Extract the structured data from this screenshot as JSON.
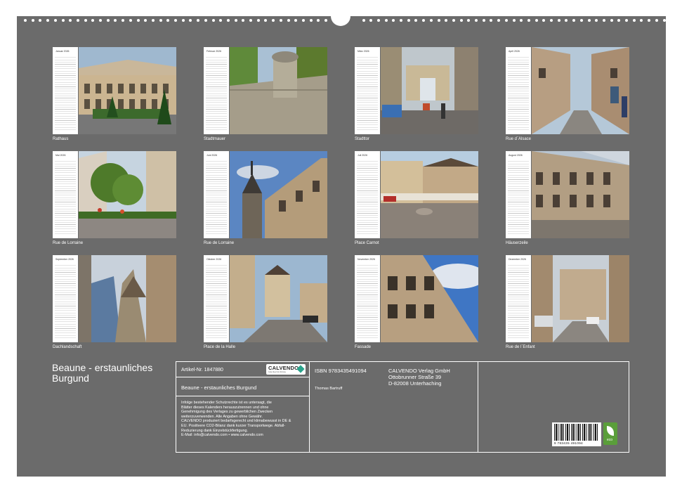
{
  "months": [
    {
      "month": "Januar",
      "year": "2026",
      "caption": "Rathaus",
      "scene": "courtyard"
    },
    {
      "month": "Februar",
      "year": "2026",
      "caption": "Stadtmauer",
      "scene": "wall"
    },
    {
      "month": "März",
      "year": "2026",
      "caption": "Stadttor",
      "scene": "gate"
    },
    {
      "month": "April",
      "year": "2026",
      "caption": "Rue d`Alsace",
      "scene": "street"
    },
    {
      "month": "Mai",
      "year": "2026",
      "caption": "Rue de Lorraine",
      "scene": "garden"
    },
    {
      "month": "Juni",
      "year": "2026",
      "caption": "Rue de Lorraine",
      "scene": "tower"
    },
    {
      "month": "Juli",
      "year": "2026",
      "caption": "Place Carnot",
      "scene": "square"
    },
    {
      "month": "August",
      "year": "2026",
      "caption": "Häuserzeile",
      "scene": "row"
    },
    {
      "month": "September",
      "year": "2026",
      "caption": "Dachlandschaft",
      "scene": "roofs"
    },
    {
      "month": "Oktober",
      "year": "2026",
      "caption": "Place de la Halle",
      "scene": "halle"
    },
    {
      "month": "November",
      "year": "2026",
      "caption": "Fassade",
      "scene": "facade"
    },
    {
      "month": "Dezember",
      "year": "2026",
      "caption": "Rue de l`Enfant",
      "scene": "lane"
    }
  ],
  "title": "Beaune - erstaunliches Burgund",
  "info": {
    "article": "Artikel-Nr. 1847880",
    "logo": "CALVENDO",
    "logo_tagline": "Gute Idee hat Vorrang",
    "subtitle": "Beaune - erstaunliches Burgund",
    "legal": [
      "Infolge bestehender Schutzrechte ist es untersagt, die",
      "Blätter dieses Kalenders herauszutrennen und ohne",
      "Genehmigung des Verlages zu gewerblichen Zwecken",
      "weiterzuverwenden. Alle Angaben ohne Gewähr.",
      "CALVENDO produziert bedarfsgerecht und klimabewusst in DE &",
      "EU. Positivere CO2-Bilanz dank kurzer Transportwege. Abfall-",
      "Reduzierung dank Einzelstückfertigung.",
      "E-Mail: info@calvendo.com • www.calvendo.com"
    ],
    "isbn": "ISBN 9783435491094",
    "author": "Thomas Bartruff",
    "publisher": [
      "CALVENDO Verlag GmbH",
      "Ottobrunner Straße 39",
      "D-82008 Unterhaching"
    ],
    "barcode_number": "9 783435 491094",
    "eco_label": "eco"
  }
}
